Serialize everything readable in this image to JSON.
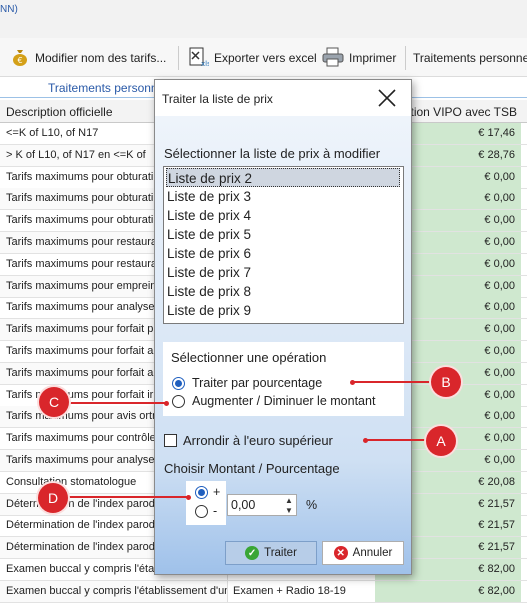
{
  "app": {
    "tab_fragment": "NN)",
    "toolbar": {
      "modify_label": "Modifier nom des tarifs...",
      "export_label": "Exporter vers excel",
      "print_label": "Imprimer",
      "treatments_label": "Traitements personne"
    },
    "subtab_label": "Traitements personne",
    "grid": {
      "col_description": "Description officielle",
      "col_amount": "ention VIPO avec TSB",
      "rows": [
        {
          "desc": "<=K of L10, of N17",
          "code": "",
          "amount": "€ 17,46"
        },
        {
          "desc": "> K of L10, of N17 en <=K of",
          "code": "",
          "amount": "€ 28,76"
        },
        {
          "desc": "Tarifs maximums pour obturati",
          "code": "",
          "amount": "€ 0,00"
        },
        {
          "desc": "Tarifs maximums pour obturati",
          "code": "",
          "amount": "€ 0,00"
        },
        {
          "desc": "Tarifs maximums pour obturati",
          "code": "",
          "amount": "€ 0,00"
        },
        {
          "desc": "Tarifs maximums pour restaura",
          "code": "",
          "amount": "€ 0,00"
        },
        {
          "desc": "Tarifs maximums pour restaura",
          "code": "",
          "amount": "€ 0,00"
        },
        {
          "desc": "Tarifs maximums pour emprein",
          "code": "",
          "amount": "€ 0,00"
        },
        {
          "desc": "Tarifs maximums pour analyse",
          "code": "",
          "amount": "€ 0,00"
        },
        {
          "desc": "Tarifs maximums pour forfait p",
          "code": "",
          "amount": "€ 0,00"
        },
        {
          "desc": "Tarifs maximums pour forfait a",
          "code": "",
          "amount": "€ 0,00"
        },
        {
          "desc": "Tarifs maximums pour forfait a",
          "code": "",
          "amount": "€ 0,00"
        },
        {
          "desc": "Tarifs maximums pour forfait ir",
          "code": "",
          "amount": "€ 0,00"
        },
        {
          "desc": "Tarifs maximums pour avis ortr",
          "code": "",
          "amount": "€ 0,00"
        },
        {
          "desc": "Tarifs maximums pour contrôle",
          "code": "",
          "amount": "€ 0,00"
        },
        {
          "desc": "Tarifs maximums pour analyse",
          "code": "",
          "amount": "€ 0,00"
        },
        {
          "desc": "Consultation stomatologue",
          "code": "",
          "amount": "€ 20,08"
        },
        {
          "desc": "Détermination de l'index parod",
          "code": "",
          "amount": "€ 21,57"
        },
        {
          "desc": "Détermination de l'index parod",
          "code": "",
          "amount": "€ 21,57"
        },
        {
          "desc": "Détermination de l'index parod",
          "code": "",
          "amount": "€ 21,57"
        },
        {
          "desc": "Examen buccal y compris l'établ",
          "code": "",
          "amount": "€ 82,00"
        },
        {
          "desc": "Examen buccal y compris l'établissement d'un",
          "code": "Examen + Radio 18-19",
          "amount": "€ 82,00"
        }
      ]
    }
  },
  "dialog": {
    "title": "Traiter la liste de prix",
    "select_list_label": "Sélectionner la liste de prix à modifier",
    "lists": [
      "Liste de prix 2",
      "Liste de prix 3",
      "Liste de prix 4",
      "Liste de prix 5",
      "Liste de prix 6",
      "Liste de prix 7",
      "Liste de prix 8",
      "Liste de prix 9"
    ],
    "selected_list": "Liste de prix 2",
    "operation_label": "Sélectionner une opération",
    "op_percent": "Traiter par pourcentage",
    "op_amount": "Augmenter / Diminuer le montant",
    "round_label": "Arrondir à l'euro supérieur",
    "amount_percent_label": "Choisir Montant / Pourcentage",
    "plus": "+",
    "minus": "-",
    "value": "0,00",
    "unit": "%",
    "ok_label": "Traiter",
    "cancel_label": "Annuler"
  },
  "annotations": [
    "A",
    "B",
    "C",
    "D"
  ],
  "colors": {
    "annotation": "#d9262b",
    "amount_cell": "#cfe8cf",
    "accent": "#1f5fbf"
  }
}
